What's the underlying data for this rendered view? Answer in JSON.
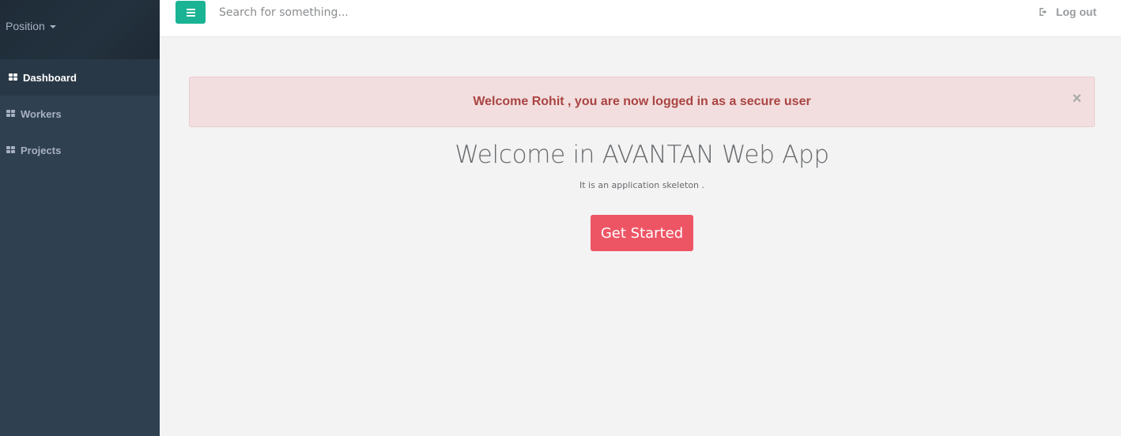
{
  "sidebar": {
    "profile_label": "Position",
    "items": [
      {
        "label": "Dashboard",
        "icon": "grid-icon",
        "active": true
      },
      {
        "label": "Workers",
        "icon": "grid-icon",
        "active": false
      },
      {
        "label": "Projects",
        "icon": "grid-icon",
        "active": false
      }
    ]
  },
  "topbar": {
    "menu_icon": "hamburger-icon",
    "search_placeholder": "Search for something...",
    "search_value": "",
    "logout_label": "Log out",
    "logout_icon": "sign-out-icon"
  },
  "alert": {
    "message": "Welcome Rohit , you are now logged in as a secure user",
    "close_glyph": "×"
  },
  "hero": {
    "title": "Welcome in AVANTAN Web App",
    "subtitle": "It is an application skeleton .",
    "cta_label": "Get Started"
  },
  "colors": {
    "sidebar_bg": "#2f4050",
    "sidebar_active_bg": "#293846",
    "menu_button": "#1ab394",
    "alert_bg": "#f2dede",
    "alert_text": "#a94442",
    "cta": "#ed5565",
    "page_bg": "#f3f3f4"
  }
}
